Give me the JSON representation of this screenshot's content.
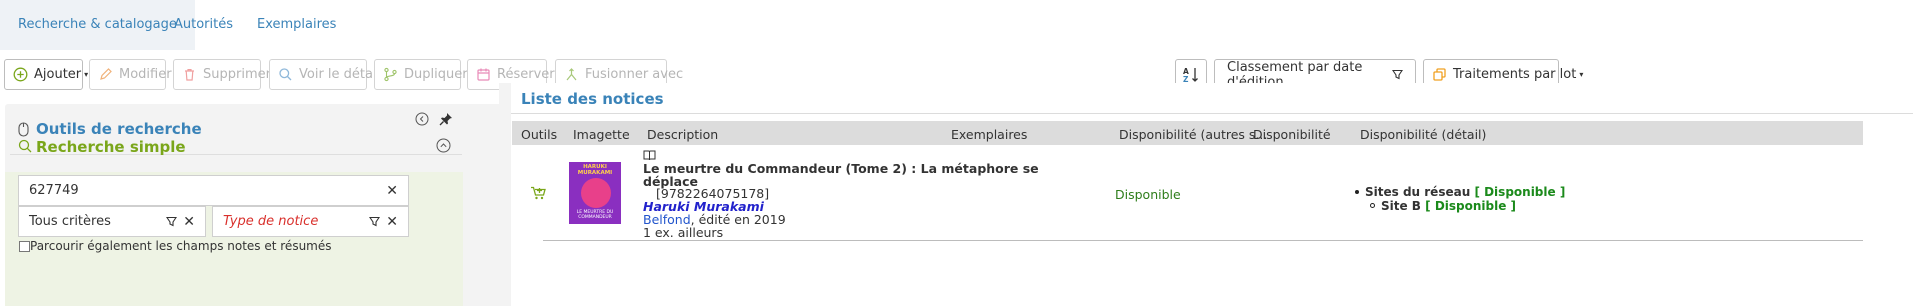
{
  "tabs": [
    {
      "label": "Recherche & catalogage",
      "active": true
    },
    {
      "label": "Autorités",
      "active": false
    },
    {
      "label": "Exemplaires",
      "active": false
    }
  ],
  "toolbar": {
    "add": "Ajouter",
    "modify": "Modifier",
    "delete": "Supprimer",
    "view_detail": "Voir le détail",
    "duplicate": "Dupliquer",
    "reserve": "Réserver",
    "merge": "Fusionner avec",
    "sort_value": "Classement par date d'édition",
    "batch": "Traitements par lot"
  },
  "search_panel": {
    "title": "Outils de recherche",
    "simple_title": "Recherche simple",
    "query": "627749",
    "criteria": "Tous critères",
    "notice_type_placeholder": "Type de notice",
    "checkbox_label": "Parcourir également les champs notes et résumés",
    "checkbox_checked": false
  },
  "results": {
    "title": "Liste des notices",
    "columns": [
      "Outils",
      "Imagette",
      "Description",
      "Exemplaires",
      "Disponibilité (autres s...",
      "Disponibilité",
      "Disponibilité (détail)"
    ],
    "rows": [
      {
        "cover_author": "HARUKI MURAKAMI",
        "cover_title": "LE MEURTRE DU COMMANDEUR",
        "title_line1": "Le meurtre du Commandeur (Tome 2) : La métaphore se",
        "title_line2": "déplace",
        "isbn": "[9782264075178]",
        "author": "Haruki Murakami",
        "publisher": "Belfond",
        "edition": ", édité en 2019",
        "copies": "1 ex. ailleurs",
        "availability": "Disponible",
        "detail_network_label": "Sites du réseau",
        "detail_network_status": "[ Disponible ]",
        "detail_site_label": "Site B",
        "detail_site_status": "[ Disponible ]"
      }
    ]
  },
  "colors": {
    "link_blue": "#3a83b8",
    "simple_green": "#7aa61a",
    "available_green": "#1b8a1b",
    "placeholder_red": "#d9302c",
    "cover_purple": "#8a2fc0",
    "cover_pink": "#e8408a"
  }
}
